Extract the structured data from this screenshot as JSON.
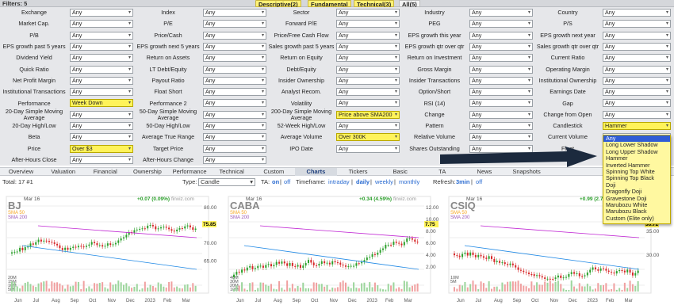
{
  "header": {
    "filters_label": "Filters: 5"
  },
  "filter_tabs": [
    {
      "label": "Descriptive(2)",
      "active": false
    },
    {
      "label": "Fundamental",
      "active": false
    },
    {
      "label": "Technical(3)",
      "active": false
    },
    {
      "label": "All(5)",
      "active": true
    }
  ],
  "filters": [
    [
      "Exchange",
      "Any",
      "Index",
      "Any",
      "Sector",
      "Any",
      "Industry",
      "Any",
      "Country",
      "Any"
    ],
    [
      "Market Cap.",
      "Any",
      "P/E",
      "Any",
      "Forward P/E",
      "Any",
      "PEG",
      "Any",
      "P/S",
      "Any"
    ],
    [
      "P/B",
      "Any",
      "Price/Cash",
      "Any",
      "Price/Free Cash Flow",
      "Any",
      "EPS growth this year",
      "Any",
      "EPS growth next year",
      "Any"
    ],
    [
      "EPS growth past 5 years",
      "Any",
      "EPS growth next 5 years",
      "Any",
      "Sales growth past 5 years",
      "Any",
      "EPS growth qtr over qtr",
      "Any",
      "Sales growth qtr over qtr",
      "Any"
    ],
    [
      "Dividend Yield",
      "Any",
      "Return on Assets",
      "Any",
      "Return on Equity",
      "Any",
      "Return on Investment",
      "Any",
      "Current Ratio",
      "Any"
    ],
    [
      "Quick Ratio",
      "Any",
      "LT Debt/Equity",
      "Any",
      "Debt/Equity",
      "Any",
      "Gross Margin",
      "Any",
      "Operating Margin",
      "Any"
    ],
    [
      "Net Profit Margin",
      "Any",
      "Payout Ratio",
      "Any",
      "Insider Ownership",
      "Any",
      "Insider Transactions",
      "Any",
      "Institutional Ownership",
      "Any"
    ],
    [
      "Institutional Transactions",
      "Any",
      "Float Short",
      "Any",
      "Analyst Recom.",
      "Any",
      "Option/Short",
      "Any",
      "Earnings Date",
      "Any"
    ],
    [
      "Performance",
      "Week Down",
      "Performance 2",
      "Any",
      "Volatility",
      "Any",
      "RSI (14)",
      "Any",
      "Gap",
      "Any"
    ],
    [
      "20-Day Simple Moving Average",
      "Any",
      "50-Day Simple Moving Average",
      "Any",
      "200-Day Simple Moving Average",
      "Price above SMA200",
      "Change",
      "Any",
      "Change from Open",
      "Any"
    ],
    [
      "20-Day High/Low",
      "Any",
      "50-Day High/Low",
      "Any",
      "52-Week High/Low",
      "Any",
      "Pattern",
      "Any",
      "Candlestick",
      "Hammer"
    ],
    [
      "Beta",
      "Any",
      "Average True Range",
      "Any",
      "Average Volume",
      "Over 300K",
      "Relative Volume",
      "Any",
      "Current Volume",
      "Any"
    ],
    [
      "Price",
      "Over $3",
      "Target Price",
      "Any",
      "IPO Date",
      "Any",
      "Shares Outstanding",
      "Any",
      "Float",
      "Any"
    ],
    [
      "After-Hours Close",
      "Any",
      "After-Hours Change",
      "Any",
      "",
      "",
      "",
      "",
      "",
      ""
    ]
  ],
  "view_tabs": [
    "Overview",
    "Valuation",
    "Financial",
    "Ownership",
    "Performance",
    "Technical",
    "Custom",
    "Charts",
    "Tickers",
    "Basic",
    "TA",
    "News",
    "Snapshots",
    "",
    "",
    ""
  ],
  "active_view": "Charts",
  "chart_bar": {
    "total": "Total: 17 #1",
    "type_label": "Type:",
    "type_value": "Candle",
    "ta_label": "TA:",
    "ta_on": "on",
    "ta_off": "off",
    "timeframe_label": "Timeframe:",
    "tf_intraday": "intraday",
    "tf_daily": "daily",
    "tf_weekly": "weekly",
    "tf_monthly": "monthly",
    "refresh_label": "Refresh:",
    "refresh_3min": "3min",
    "refresh_off": "off"
  },
  "candlestick_options": [
    "Any",
    "Long Lower Shadow",
    "Long Upper Shadow",
    "Hammer",
    "Inverted Hammer",
    "Spinning Top White",
    "Spinning Top Black",
    "Doji",
    "Dragonfly Doji",
    "Gravestone Doji",
    "Marubozu White",
    "Marubozu Black",
    "Custom (Elite only)"
  ],
  "candlestick_selected": "Any",
  "charts": [
    {
      "ticker": "BJ",
      "date": "Mar 16",
      "change": "+0.07 (0.09%)",
      "brand": "finviz.com",
      "sma50": "SMA 50",
      "sma200": "SMA 200",
      "price": "75.85",
      "ticks": [
        "80.00",
        "75.00",
        "70.00",
        "65.00"
      ],
      "vol": [
        "20M",
        "15M",
        "10M",
        "5M"
      ],
      "months": [
        "Jun",
        "Jul",
        "Aug",
        "Sep",
        "Oct",
        "Nov",
        "Dec",
        "2023",
        "Feb",
        "Mar"
      ]
    },
    {
      "ticker": "CABA",
      "date": "Mar 16",
      "change": "+0.34 (4.59%)",
      "brand": "finviz.com",
      "sma50": "SMA 50",
      "sma200": "SMA 200",
      "price": "7.75",
      "ticks": [
        "12.00",
        "10.00",
        "8.00",
        "6.00",
        "4.00",
        "2.00"
      ],
      "vol": [
        "40M",
        "30M",
        "20M",
        "10M"
      ],
      "months": [
        "Jun",
        "Jul",
        "Aug",
        "Sep",
        "Oct",
        "Nov",
        "Dec",
        "2023",
        "Feb",
        "Mar"
      ]
    },
    {
      "ticker": "CSIQ",
      "date": "Mar 16",
      "change": "+0.99 (2.72%)",
      "brand": "finviz.com",
      "sma50": "SMA 50",
      "sma200": "SMA 200",
      "price": "36.72",
      "ticks": [
        "40.00",
        "35.00",
        "30.00"
      ],
      "vol": [
        "10M",
        "5M"
      ],
      "months": [
        "Jun",
        "Jul",
        "Aug",
        "Sep",
        "Oct",
        "Nov",
        "Dec",
        "2023",
        "Feb",
        "Mar"
      ]
    }
  ],
  "colors": {
    "accent_yellow": "#fff35a",
    "link_blue": "#2a6bd1",
    "up_green": "#2ca02c",
    "down_red": "#d62728"
  }
}
